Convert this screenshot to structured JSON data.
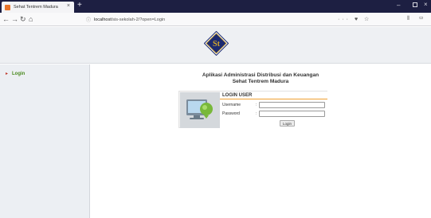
{
  "browser": {
    "tab_title": "Sehat Tentrem Madura",
    "tab_close": "×",
    "new_tab": "+",
    "url_host": "localhost",
    "url_path": "/sis-sekolah-2/?open=Login",
    "url_actions": "··· ♥ ☆"
  },
  "page": {
    "logo_text": "St",
    "sidebar": {
      "items": [
        {
          "label": "Login"
        }
      ]
    },
    "app_title_line1": "Aplikasi Administrasi Distribusi dan Keuangan",
    "app_title_line2": "Sehat Tentrem Madura",
    "login": {
      "heading": "LOGIN USER",
      "username_label": "Username",
      "password_label": "Password",
      "colon": ":",
      "username_value": "",
      "password_value": "",
      "submit_label": "Login"
    }
  },
  "colors": {
    "tabbar": "#1d1f42",
    "logo_navy": "#1c2a70",
    "logo_gold": "#d4a82a",
    "sidebar_link": "#4a8a1f",
    "bullet": "#c0392b",
    "login_underline": "#f0a030"
  }
}
